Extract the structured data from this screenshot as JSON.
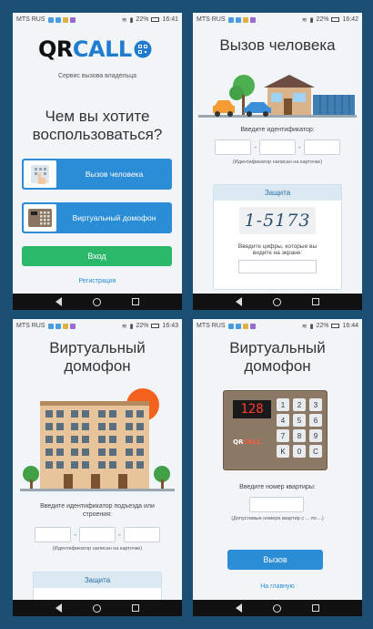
{
  "status_bars": [
    {
      "carrier": "MTS RUS",
      "battery": "22%",
      "time": "16:41"
    },
    {
      "carrier": "MTS RUS",
      "battery": "22%",
      "time": "16:42"
    },
    {
      "carrier": "MTS RUS",
      "battery": "22%",
      "time": "16:43"
    },
    {
      "carrier": "MTS RUS",
      "battery": "22%",
      "time": "16:44"
    }
  ],
  "screen1": {
    "logo_qr": "QR",
    "logo_call": "CALL",
    "subtitle": "Сервис вызова владельца",
    "question_line1": "Чем вы хотите",
    "question_line2": "воспользоваться?",
    "call_person_label": "Вызов человека",
    "virtual_intercom_label": "Виртуальный домофон",
    "login_label": "Вход",
    "register_link": "Регистрация"
  },
  "screen2": {
    "title": "Вызов человека",
    "enter_id_label": "Введите идентификатор:",
    "id_hint": "(Идентификатор написан на карточке)",
    "protection_header": "Защита",
    "captcha_text": "1-5173",
    "captcha_prompt_line1": "Введите цифры, которые вы",
    "captcha_prompt_line2": "видите на экране:"
  },
  "screen3": {
    "title_line1": "Виртуальный",
    "title_line2": "домофон",
    "enter_id_line1": "Введите идентификатор подъезда или",
    "enter_id_line2": "строения:",
    "id_hint": "(Идентификатор написан на карточке)",
    "protection_header": "Защита"
  },
  "screen4": {
    "title_line1": "Виртуальный",
    "title_line2": "домофон",
    "intercom_display": "128",
    "intercom_brand_qr": "QR",
    "intercom_brand_call": "CALL",
    "keypad": [
      "1",
      "2",
      "3",
      "4",
      "5",
      "6",
      "7",
      "8",
      "9",
      "K",
      "0",
      "C"
    ],
    "enter_apartment_label": "Введите номер квартиры:",
    "apartment_hint": "(Допустимые номера квартир с ... по ...)",
    "call_button": "Вызов",
    "home_link": "На главную"
  },
  "colors": {
    "background": "#1b4f73",
    "accent_blue": "#2a8dd6",
    "accent_green": "#2cb86a",
    "logo_blue": "#1f7ccf"
  }
}
